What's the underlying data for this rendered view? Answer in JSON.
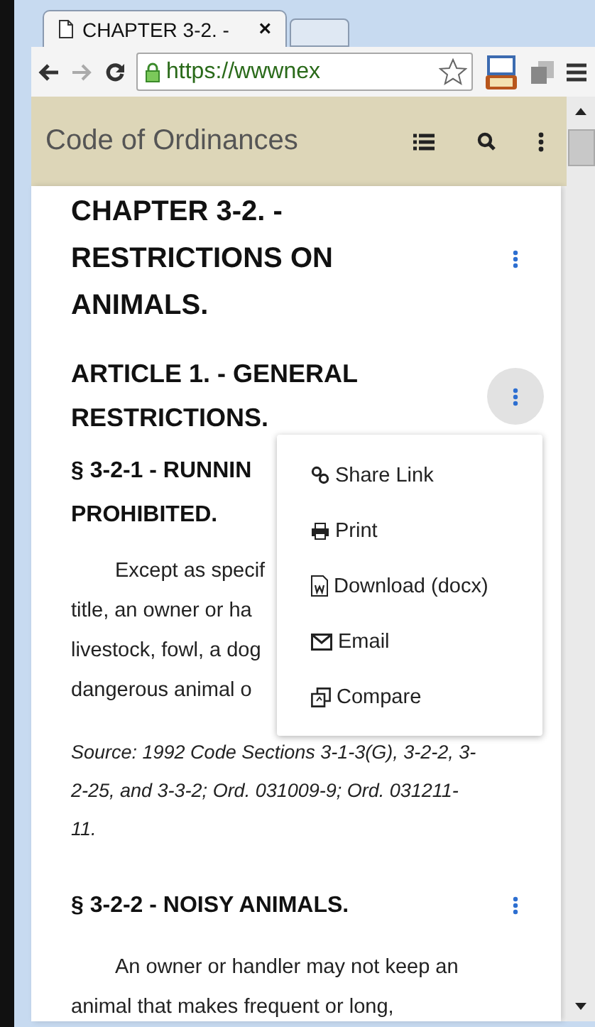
{
  "browser": {
    "tab": {
      "title": "CHAPTER 3-2. -",
      "close": "×"
    },
    "address": "https://wwwnex"
  },
  "header": {
    "title": "Code of Ordinances"
  },
  "blocks": [
    {
      "kind": "chapter",
      "lines": [
        "CHAPTER 3-2. -",
        "RESTRICTIONS ON",
        "ANIMALS."
      ],
      "kebab": {
        "active": false
      }
    },
    {
      "kind": "article",
      "lines": [
        "ARTICLE 1. - GENERAL",
        "RESTRICTIONS."
      ],
      "kebab": {
        "active": true
      }
    },
    {
      "kind": "section",
      "lines": [
        "§ 3-2-1 - RUNNIN",
        "PROHIBITED."
      ]
    },
    {
      "kind": "paragraph",
      "lines": [
        "Except as specif",
        "title, an owner or ha",
        "livestock, fowl, a dog",
        "dangerous animal o"
      ]
    },
    {
      "kind": "source",
      "lines": [
        "Source: 1992 Code Sections 3-1-3(G), 3-2-2, 3-",
        "2-25, and 3-3-2; Ord. 031009-9; Ord. 031211-",
        "11."
      ]
    },
    {
      "kind": "section",
      "lines": [
        "§ 3-2-2 - NOISY ANIMALS."
      ],
      "kebab": {
        "active": false
      }
    },
    {
      "kind": "paragraph",
      "lines": [
        "An owner or handler may not keep an",
        "animal that makes frequent or long,"
      ]
    }
  ],
  "menu": {
    "items": [
      "Share Link",
      "Print",
      "Download (docx)",
      "Email",
      "Compare"
    ]
  }
}
